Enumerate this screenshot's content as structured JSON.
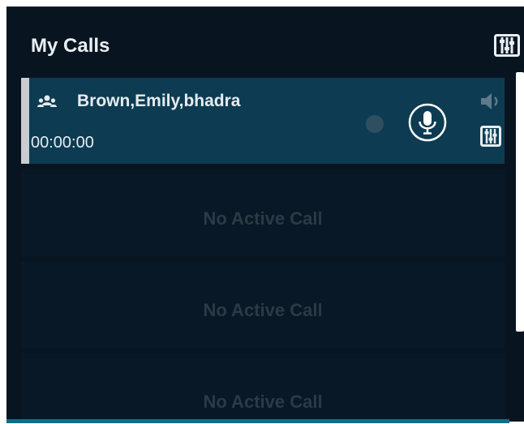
{
  "header": {
    "title": "My Calls",
    "settings_icon": "mixer-settings-icon"
  },
  "active_call": {
    "participants": "Brown,Emily,bhadra",
    "timer": "00:00:00",
    "icons": {
      "group": "group-icon",
      "status": "status-dot",
      "mic": "microphone-icon",
      "speaker": "speaker-icon",
      "mixer": "mixer-icon"
    }
  },
  "empty_slots": [
    {
      "label": "No Active Call"
    },
    {
      "label": "No Active Call"
    },
    {
      "label": "No Active Call"
    }
  ],
  "colors": {
    "background": "#081521",
    "active_row": "#0d3c52",
    "accent_bar": "#c9ccd0",
    "text": "#e6ecf0",
    "muted_text": "#2c3a46",
    "bottom_edge": "#0e6f86"
  }
}
